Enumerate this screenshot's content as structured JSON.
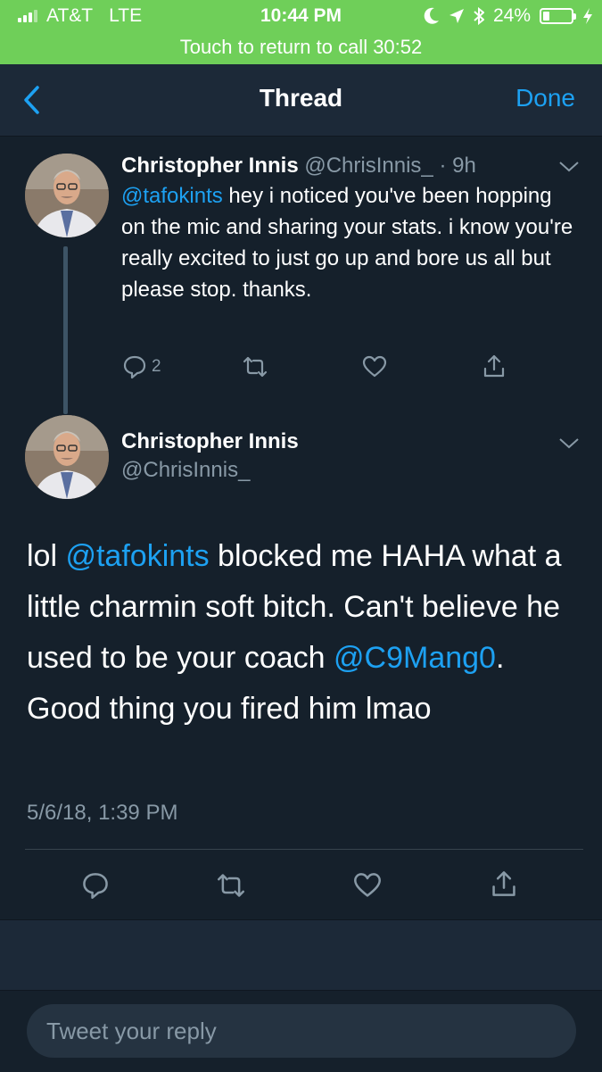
{
  "status_bar": {
    "carrier": "AT&T",
    "network": "LTE",
    "time": "10:44 PM",
    "battery_percent": "24%",
    "battery_level": 0.24,
    "icons": [
      "moon-icon",
      "location-arrow-icon",
      "bluetooth-icon",
      "battery-icon",
      "charging-bolt-icon"
    ]
  },
  "call_bar": {
    "text": "Touch to return to call 30:52"
  },
  "nav": {
    "title": "Thread",
    "done": "Done"
  },
  "tweet1": {
    "name": "Christopher Innis",
    "handle": "@ChrisInnis_",
    "time": "· 9h",
    "mention": "@tafokints",
    "text": " hey i noticed you've been hopping on the mic and sharing your stats. i know you're really excited to just go up and bore us all but please stop. thanks.",
    "reply_count": "2"
  },
  "tweet2": {
    "name": "Christopher Innis",
    "handle": "@ChrisInnis_",
    "text_1": "lol ",
    "mention_1": "@tafokints",
    "text_2": " blocked me HAHA what a little charmin soft bitch. Can't believe he used to be your coach ",
    "mention_2": "@C9Mang0",
    "text_3": ". Good thing you fired him lmao",
    "timestamp": "5/6/18, 1:39 PM"
  },
  "reply": {
    "placeholder": "Tweet your reply"
  },
  "colors": {
    "accent": "#1da1f2",
    "background": "#15202b",
    "call_green": "#6fcf59",
    "muted": "#8899a6"
  }
}
